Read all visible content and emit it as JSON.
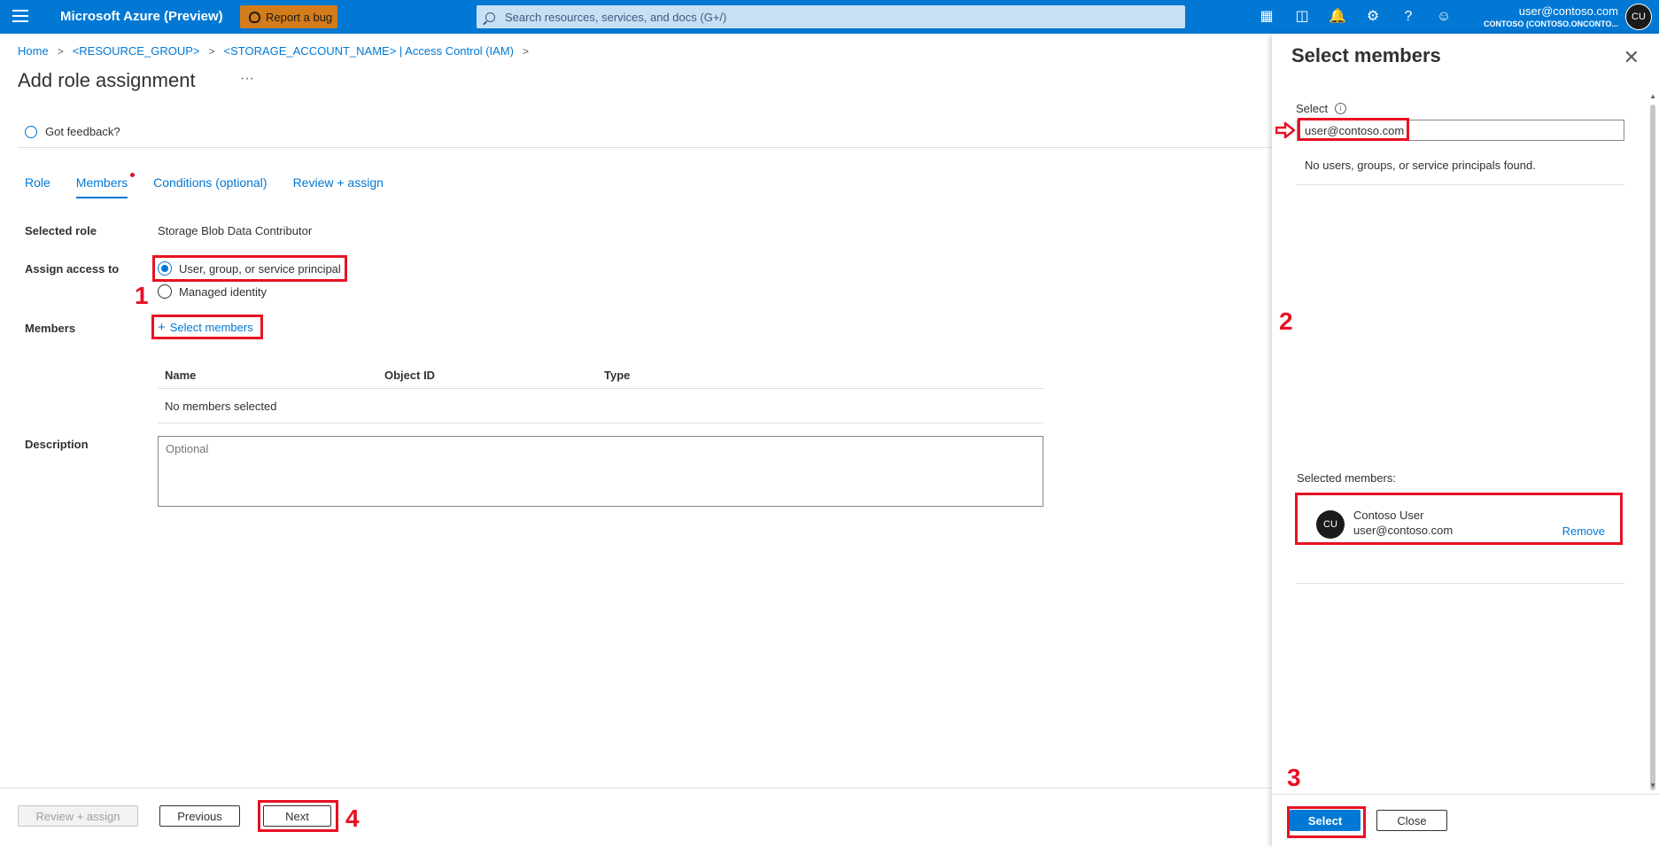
{
  "topbar": {
    "brand": "Microsoft Azure (Preview)",
    "report_bug": "Report a bug",
    "search_placeholder": "Search resources, services, and docs (G+/)",
    "account_email": "user@contoso.com",
    "account_tenant": "CONTOSO (CONTOSO.ONCONTO...",
    "avatar_initials": "CU"
  },
  "breadcrumb": [
    "Home",
    "<RESOURCE_GROUP>",
    "<STORAGE_ACCOUNT_NAME> | Access Control (IAM)"
  ],
  "page": {
    "title": "Add role assignment",
    "more": "···",
    "feedback": "Got feedback?"
  },
  "tabs": [
    "Role",
    "Members",
    "Conditions (optional)",
    "Review + assign"
  ],
  "form": {
    "selected_role_label": "Selected role",
    "selected_role_value": "Storage Blob Data Contributor",
    "assign_access_label": "Assign access to",
    "option_user": "User, group, or service principal",
    "option_managed": "Managed identity",
    "members_label": "Members",
    "select_members": "Select members",
    "table_headers": [
      "Name",
      "Object ID",
      "Type"
    ],
    "table_empty": "No members selected",
    "description_label": "Description",
    "description_placeholder": "Optional"
  },
  "footer": {
    "review_assign": "Review + assign",
    "previous": "Previous",
    "next": "Next"
  },
  "annotations": [
    "1",
    "2",
    "3",
    "4"
  ],
  "panel": {
    "title": "Select members",
    "select_label": "Select",
    "select_value": "user@contoso.com",
    "no_results": "No users, groups, or service principals found.",
    "selected_members_label": "Selected members:",
    "member": {
      "initials": "CU",
      "name": "Contoso User",
      "email": "user@contoso.com",
      "remove": "Remove"
    },
    "select_button": "Select",
    "close_button": "Close"
  },
  "colors": {
    "brand_blue": "#0078d4",
    "annotation_red": "#e81123"
  }
}
